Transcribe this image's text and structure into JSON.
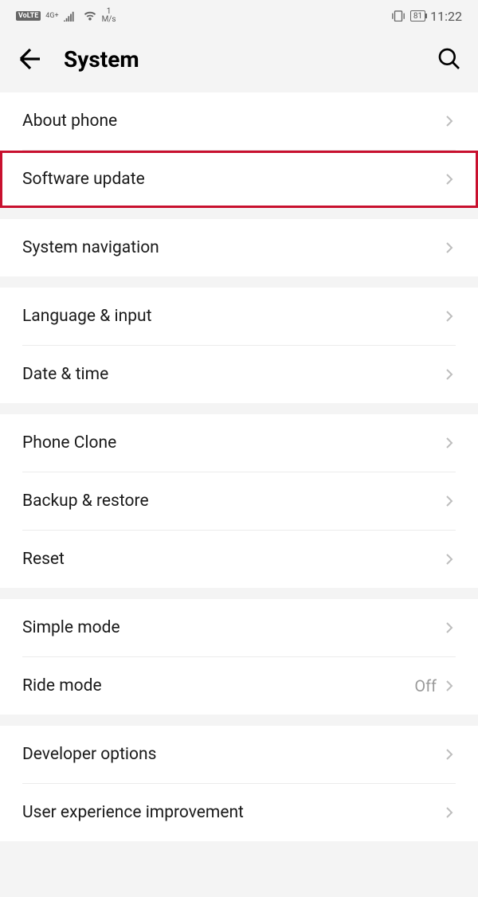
{
  "status_bar": {
    "volte": "VoLTE",
    "network_type": "4G+",
    "network_sub": "",
    "speed_value": "1",
    "speed_unit": "M/s",
    "battery": "81",
    "time": "11:22"
  },
  "header": {
    "title": "System"
  },
  "groups": [
    {
      "items": [
        {
          "label": "About phone",
          "highlighted": false
        },
        {
          "label": "Software update",
          "highlighted": true
        }
      ]
    },
    {
      "items": [
        {
          "label": "System navigation"
        }
      ]
    },
    {
      "items": [
        {
          "label": "Language & input"
        },
        {
          "label": "Date & time"
        }
      ]
    },
    {
      "items": [
        {
          "label": "Phone Clone"
        },
        {
          "label": "Backup & restore"
        },
        {
          "label": "Reset"
        }
      ]
    },
    {
      "items": [
        {
          "label": "Simple mode"
        },
        {
          "label": "Ride mode",
          "value": "Off"
        }
      ]
    },
    {
      "items": [
        {
          "label": "Developer options"
        },
        {
          "label": "User experience improvement"
        }
      ]
    }
  ]
}
